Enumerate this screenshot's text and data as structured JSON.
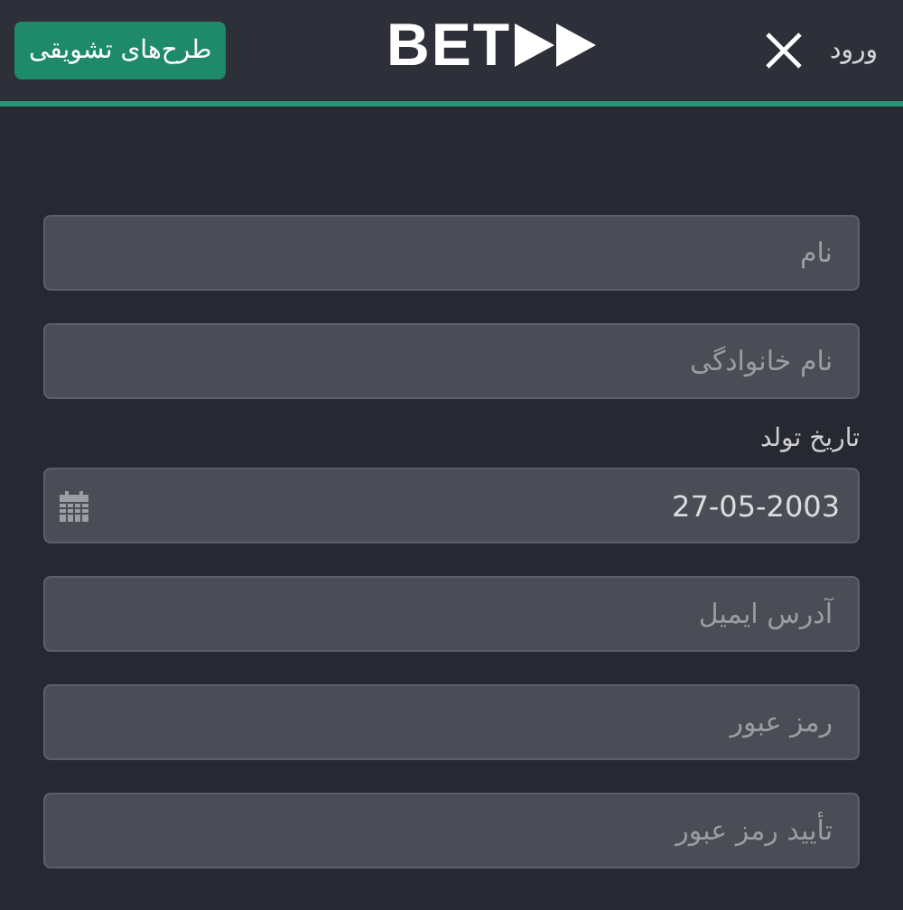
{
  "header": {
    "promo_button": "طرح‌های تشویقی",
    "logo": "BET",
    "login_link": "ورود"
  },
  "form": [
    {
      "kind": "text",
      "placeholder": "نام"
    },
    {
      "kind": "text",
      "placeholder": "نام خانوادگی"
    },
    {
      "kind": "label",
      "text": "تاریخ تولد"
    },
    {
      "kind": "date",
      "value": "27-05-2003"
    },
    {
      "kind": "text",
      "placeholder": "آدرس ایمیل"
    },
    {
      "kind": "text",
      "placeholder": "رمز عبور"
    },
    {
      "kind": "text",
      "placeholder": "تأیید رمز عبور"
    }
  ]
}
